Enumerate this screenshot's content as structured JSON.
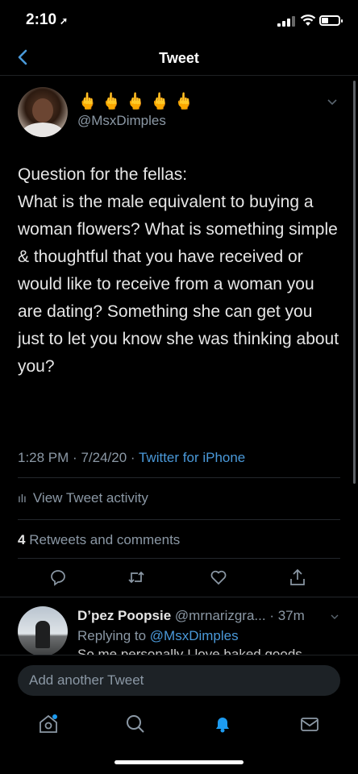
{
  "status_bar": {
    "time": "2:10",
    "battery_level": 0.45
  },
  "nav": {
    "title": "Tweet"
  },
  "tweet": {
    "display_name": "🖕🖕🖕🖕🖕",
    "handle": "@MsxDimples",
    "text": "Question for the fellas:\nWhat is the male equivalent to buying a woman flowers? What is something simple & thoughtful that you have received or would like to receive from a woman you are dating? Something she can get you just to let you know she was thinking about you?",
    "time": "1:28 PM",
    "date": "7/24/20",
    "source": "Twitter for iPhone",
    "activity_label": "View Tweet activity",
    "retweets_count": "4",
    "retweets_label": "Retweets and comments"
  },
  "reply": {
    "name": "D’pez Poopsie",
    "handle": "@mrnarizgra...",
    "age": "· 37m",
    "replying_prefix": "Replying to",
    "replying_to": "@MsxDimples",
    "text_partial": "So me personally I love baked goods"
  },
  "compose": {
    "placeholder": "Add another Tweet"
  },
  "icons": {
    "back": "chevron-left-icon",
    "caret": "chevron-down-icon",
    "reply": "reply-icon",
    "retweet": "retweet-icon",
    "like": "heart-icon",
    "share": "share-icon",
    "home": "home-icon",
    "search": "search-icon",
    "notifications": "bell-icon",
    "messages": "mail-icon"
  },
  "colors": {
    "accent": "#4a99d9",
    "notification_active": "#1d9bf0",
    "secondary_text": "#8b98a5"
  }
}
